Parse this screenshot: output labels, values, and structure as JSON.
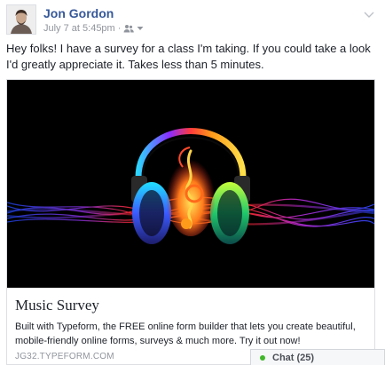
{
  "post": {
    "author": "Jon Gordon",
    "timestamp": "July 7 at 5:45pm",
    "separator": "·",
    "audience_icon": "friends-icon",
    "options_icon": "chevron-down-icon",
    "text": "Hey folks! I have a survey for a class I'm taking. If you could take a look I'd greatly appreciate it. Takes less than 5 minutes."
  },
  "link_card": {
    "image_icon": "headphones-music-icon",
    "title": "Music Survey",
    "description": "Built with Typeform, the FREE online form builder that lets you create beautiful, mobile-friendly online forms, surveys & much more. Try it out now!",
    "domain": "JG32.TYPEFORM.COM"
  },
  "chat": {
    "label": "Chat (25)",
    "status_color": "#42b72a"
  },
  "colors": {
    "author_link": "#365899",
    "meta_text": "#90949c"
  }
}
